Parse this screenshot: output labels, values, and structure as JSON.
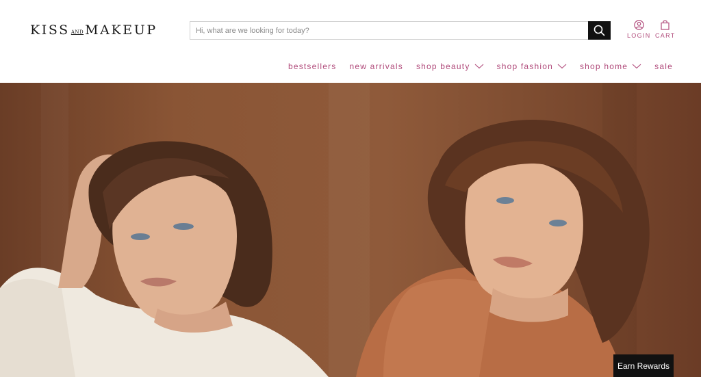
{
  "brand": {
    "logo_part1": "KISS",
    "logo_small": "AND",
    "logo_part2": "MAKEUP"
  },
  "search": {
    "placeholder": "Hi, what are we looking for today?",
    "value": "",
    "icon": "search-icon"
  },
  "account": {
    "login_label": "LOGIN",
    "login_icon": "user-icon",
    "cart_label": "CART",
    "cart_icon": "shopping-bag-icon"
  },
  "nav": {
    "items": [
      {
        "label": "bestsellers",
        "dropdown": false
      },
      {
        "label": "new arrivals",
        "dropdown": false
      },
      {
        "label": "shop beauty",
        "dropdown": true
      },
      {
        "label": "shop fashion",
        "dropdown": true
      },
      {
        "label": "shop home",
        "dropdown": true
      },
      {
        "label": "sale",
        "dropdown": false
      }
    ]
  },
  "hero": {
    "image": "two-models-in-knit-sweaters-photo"
  },
  "rewards": {
    "label": "Earn Rewards"
  },
  "colors": {
    "accent": "#b04a7a",
    "dark": "#111111",
    "hero_bg": "#8a5535"
  }
}
